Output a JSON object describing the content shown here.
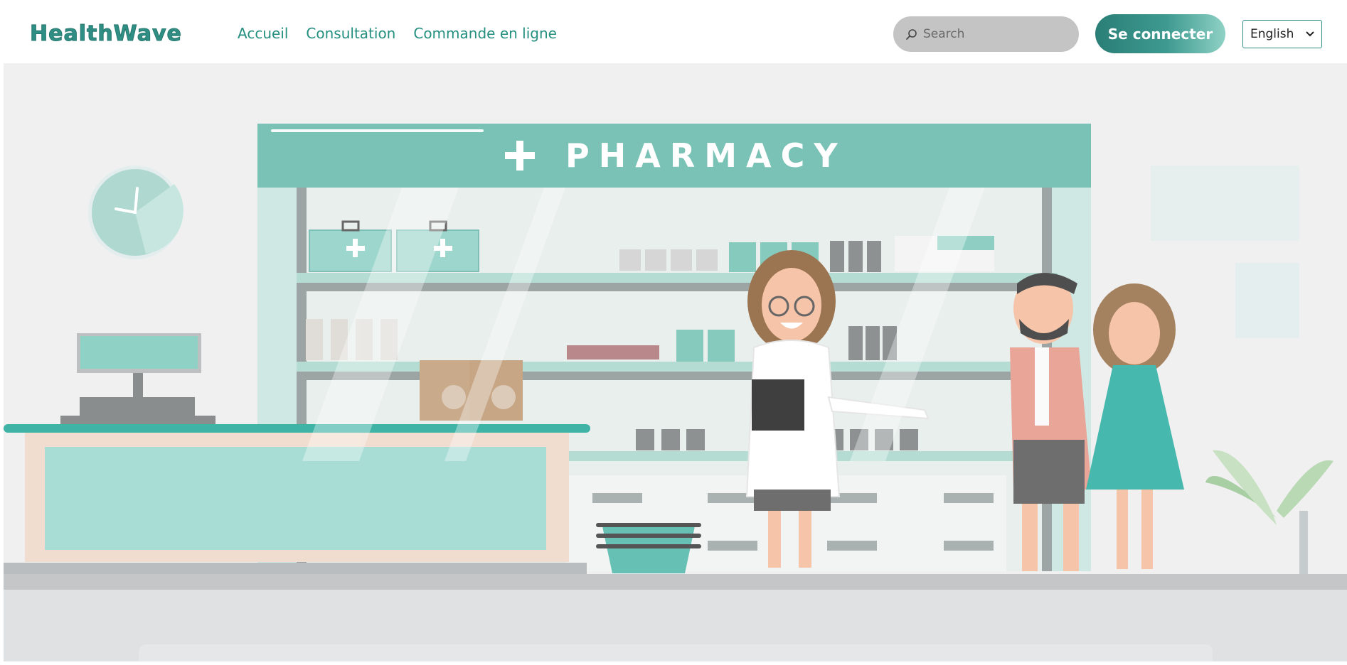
{
  "header": {
    "logo": "HealthWave",
    "nav": [
      {
        "label": "Accueil"
      },
      {
        "label": "Consultation"
      },
      {
        "label": "Commande en ligne"
      }
    ],
    "search": {
      "placeholder": "Search",
      "icon": "search-icon"
    },
    "login_label": "Se connecter",
    "language": {
      "selected": "English"
    }
  },
  "hero": {
    "sign_text": "PHARMACY"
  },
  "colors": {
    "brand": "#2f8f84",
    "teal_light": "#8fd1c5",
    "background": "#f0f0f0"
  }
}
